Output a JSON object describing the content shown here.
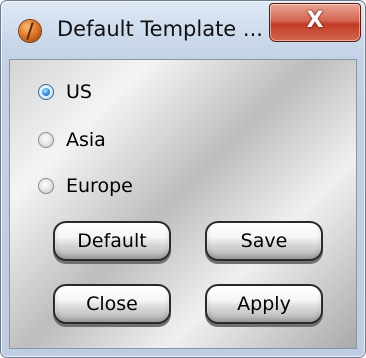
{
  "window": {
    "title": "Default Template ...",
    "close_glyph": "X",
    "app_icon": "orange-globe-icon",
    "close_color": "#c9402b"
  },
  "regions": {
    "options": [
      {
        "label": "US",
        "checked": true
      },
      {
        "label": "Asia",
        "checked": false
      },
      {
        "label": "Europe",
        "checked": false
      }
    ]
  },
  "buttons": {
    "default_label": "Default",
    "save_label": "Save",
    "close_label": "Close",
    "apply_label": "Apply"
  }
}
